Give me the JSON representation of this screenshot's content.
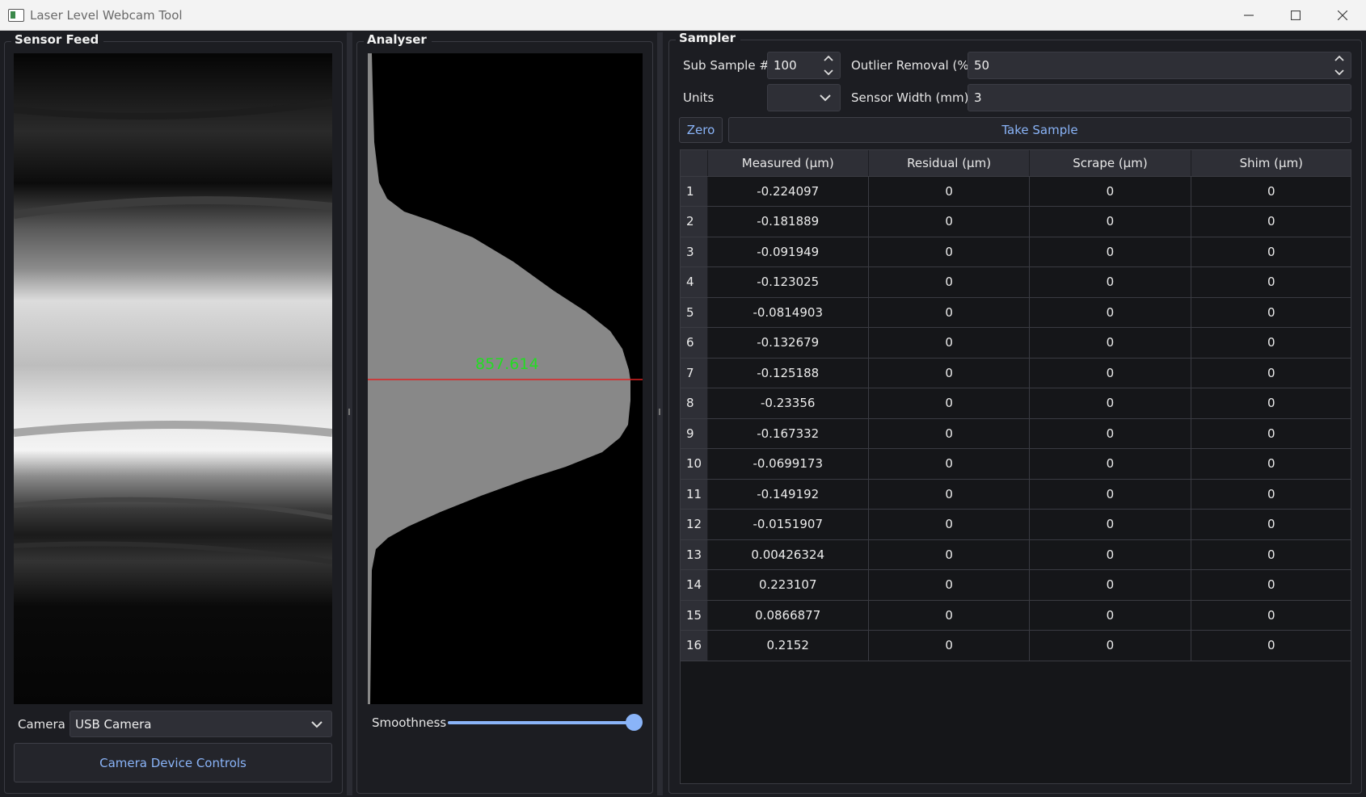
{
  "window": {
    "title": "Laser Level Webcam Tool"
  },
  "sensor_feed": {
    "title": "Sensor Feed",
    "camera_label": "Camera",
    "camera_value": "USB Camera",
    "device_controls_label": "Camera Device Controls"
  },
  "analyser": {
    "title": "Analyser",
    "center_value": "857.614",
    "smoothness_label": "Smoothness",
    "smoothness_level": 1.0
  },
  "sampler": {
    "title": "Sampler",
    "sub_sample_label": "Sub Sample #",
    "sub_sample_value": "100",
    "outlier_label": "Outlier Removal (%)",
    "outlier_value": "50",
    "units_label": "Units",
    "units_value": "",
    "sensor_width_label": "Sensor Width (mm)",
    "sensor_width_value": "3",
    "zero_label": "Zero",
    "take_sample_label": "Take Sample",
    "table": {
      "headers": [
        "Measured (µm)",
        "Residual (µm)",
        "Scrape (µm)",
        "Shim (µm)"
      ],
      "rows": [
        {
          "n": "1",
          "measured": "-0.224097",
          "residual": "0",
          "scrape": "0",
          "shim": "0"
        },
        {
          "n": "2",
          "measured": "-0.181889",
          "residual": "0",
          "scrape": "0",
          "shim": "0"
        },
        {
          "n": "3",
          "measured": "-0.091949",
          "residual": "0",
          "scrape": "0",
          "shim": "0"
        },
        {
          "n": "4",
          "measured": "-0.123025",
          "residual": "0",
          "scrape": "0",
          "shim": "0"
        },
        {
          "n": "5",
          "measured": "-0.0814903",
          "residual": "0",
          "scrape": "0",
          "shim": "0"
        },
        {
          "n": "6",
          "measured": "-0.132679",
          "residual": "0",
          "scrape": "0",
          "shim": "0"
        },
        {
          "n": "7",
          "measured": "-0.125188",
          "residual": "0",
          "scrape": "0",
          "shim": "0"
        },
        {
          "n": "8",
          "measured": "-0.23356",
          "residual": "0",
          "scrape": "0",
          "shim": "0"
        },
        {
          "n": "9",
          "measured": "-0.167332",
          "residual": "0",
          "scrape": "0",
          "shim": "0"
        },
        {
          "n": "10",
          "measured": "-0.0699173",
          "residual": "0",
          "scrape": "0",
          "shim": "0"
        },
        {
          "n": "11",
          "measured": "-0.149192",
          "residual": "0",
          "scrape": "0",
          "shim": "0"
        },
        {
          "n": "12",
          "measured": "-0.0151907",
          "residual": "0",
          "scrape": "0",
          "shim": "0"
        },
        {
          "n": "13",
          "measured": "0.00426324",
          "residual": "0",
          "scrape": "0",
          "shim": "0"
        },
        {
          "n": "14",
          "measured": "0.223107",
          "residual": "0",
          "scrape": "0",
          "shim": "0"
        },
        {
          "n": "15",
          "measured": "0.0866877",
          "residual": "0",
          "scrape": "0",
          "shim": "0"
        },
        {
          "n": "16",
          "measured": "0.2152",
          "residual": "0",
          "scrape": "0",
          "shim": "0"
        }
      ]
    }
  },
  "colors": {
    "accent": "#8ab4f8",
    "readout": "#22dd22",
    "center_line": "#dd2222",
    "profile_fill": "#888888"
  }
}
